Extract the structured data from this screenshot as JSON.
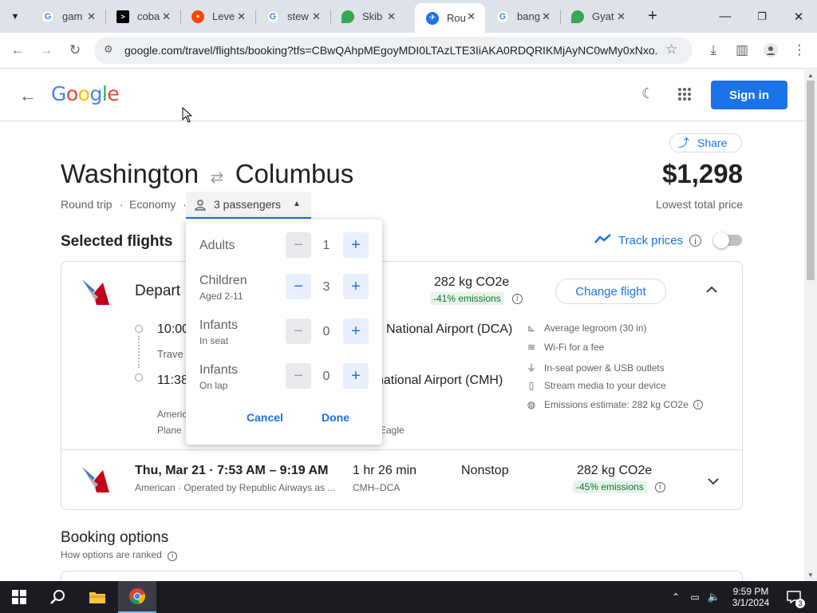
{
  "browser": {
    "tabs": [
      {
        "label": "gam",
        "icon": "google-icon"
      },
      {
        "label": "coba",
        "icon": "terminal-icon"
      },
      {
        "label": "Leve",
        "icon": "reddit-icon"
      },
      {
        "label": "stew",
        "icon": "google-icon"
      },
      {
        "label": "Skib",
        "icon": "maps-icon"
      },
      {
        "label": "Rou",
        "icon": "flights-icon"
      },
      {
        "label": "bang",
        "icon": "google-icon"
      },
      {
        "label": "Gyat",
        "icon": "maps-icon"
      }
    ],
    "url": "google.com/travel/flights/booking?tfs=CBwQAhpMEgoyMDI0LTAzLTE3IiAKA0RDQRIKMjAyNC0wMy0xNxo..."
  },
  "header": {
    "logo": "Google",
    "signin": "Sign in"
  },
  "trip": {
    "origin": "Washington",
    "destination": "Columbus",
    "price": "$1,298",
    "price_label": "Lowest total price",
    "share_label": "Share",
    "trip_type": "Round trip",
    "cabin": "Economy",
    "passengers": "3 passengers"
  },
  "selected": {
    "heading": "Selected flights",
    "track_prices": "Track prices"
  },
  "departing": {
    "label": "Depart",
    "time_dep": "10:00",
    "time_arr": "11:38",
    "travel": "Trave",
    "airline_line": "Americ",
    "plane_line": "Plane",
    "airport_dep": "National Airport (DCA)",
    "airport_arr": "national Airport (CMH)",
    "eagle": "Eagle",
    "co2": "282 kg CO2e",
    "emissions": "-41% emissions",
    "change": "Change flight",
    "amenities": [
      {
        "icon": "legroom-icon",
        "text": "Average legroom (30 in)"
      },
      {
        "icon": "wifi-icon",
        "text": "Wi-Fi for a fee"
      },
      {
        "icon": "power-icon",
        "text": "In-seat power & USB outlets"
      },
      {
        "icon": "stream-icon",
        "text": "Stream media to your device"
      },
      {
        "icon": "globe-icon",
        "text": "Emissions estimate: 282 kg CO2e"
      }
    ]
  },
  "returning": {
    "date_time": "Thu, Mar 21 · 7:53 AM – 9:19 AM",
    "airline": "American · Operated by Republic Airways as ...",
    "duration": "1 hr 26 min",
    "route": "CMH–DCA",
    "stops": "Nonstop",
    "co2": "282 kg CO2e",
    "emissions": "-45% emissions"
  },
  "booking": {
    "heading": "Booking options",
    "sub": "How options are ranked"
  },
  "popup": {
    "rows": [
      {
        "label": "Adults",
        "sub": "",
        "count": "1"
      },
      {
        "label": "Children",
        "sub": "Aged 2-11",
        "count": "3"
      },
      {
        "label": "Infants",
        "sub": "In seat",
        "count": "0"
      },
      {
        "label": "Infants",
        "sub": "On lap",
        "count": "0"
      }
    ],
    "cancel": "Cancel",
    "done": "Done"
  },
  "taskbar": {
    "time": "9:59 PM",
    "date": "3/1/2024",
    "notifications": "3"
  },
  "colors": {
    "accent": "#1a73e8",
    "emissions_bg": "#e6f4ea",
    "emissions_fg": "#137333"
  }
}
